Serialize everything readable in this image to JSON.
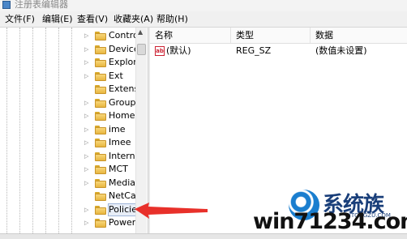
{
  "window": {
    "title": "注册表编辑器"
  },
  "menu": [
    "文件(F)",
    "编辑(E)",
    "查看(V)",
    "收藏夹(A)",
    "帮助(H)"
  ],
  "tree": {
    "items": [
      {
        "label": "Contro",
        "expander": "▷"
      },
      {
        "label": "Device",
        "expander": "▷"
      },
      {
        "label": "Explor",
        "expander": "▷"
      },
      {
        "label": "Ext",
        "expander": "▷"
      },
      {
        "label": "Extens",
        "expander": ""
      },
      {
        "label": "Group",
        "expander": "▷"
      },
      {
        "label": "Home",
        "expander": "▷"
      },
      {
        "label": "ime",
        "expander": "▷"
      },
      {
        "label": "Imee",
        "expander": "▷"
      },
      {
        "label": "Interne",
        "expander": "▷"
      },
      {
        "label": "MCT",
        "expander": "▷"
      },
      {
        "label": "Media",
        "expander": "▷"
      },
      {
        "label": "NetCa",
        "expander": ""
      },
      {
        "label": "Policie",
        "expander": "▷",
        "selected": true
      },
      {
        "label": "Power",
        "expander": "▷"
      }
    ]
  },
  "list": {
    "columns": [
      "名称",
      "类型",
      "数据"
    ],
    "rows": [
      {
        "name": "(默认)",
        "type": "REG_SZ",
        "data": "(数值未设置)",
        "icon": "ab-string-value-icon"
      }
    ]
  },
  "watermark": {
    "brand_cn": "系统族",
    "site_small": "XITONGZU.COM",
    "site": "win71234.com"
  },
  "colors": {
    "arrow": "#e8302a",
    "selection": "#e8eef7",
    "folder": "#f7d77a"
  }
}
